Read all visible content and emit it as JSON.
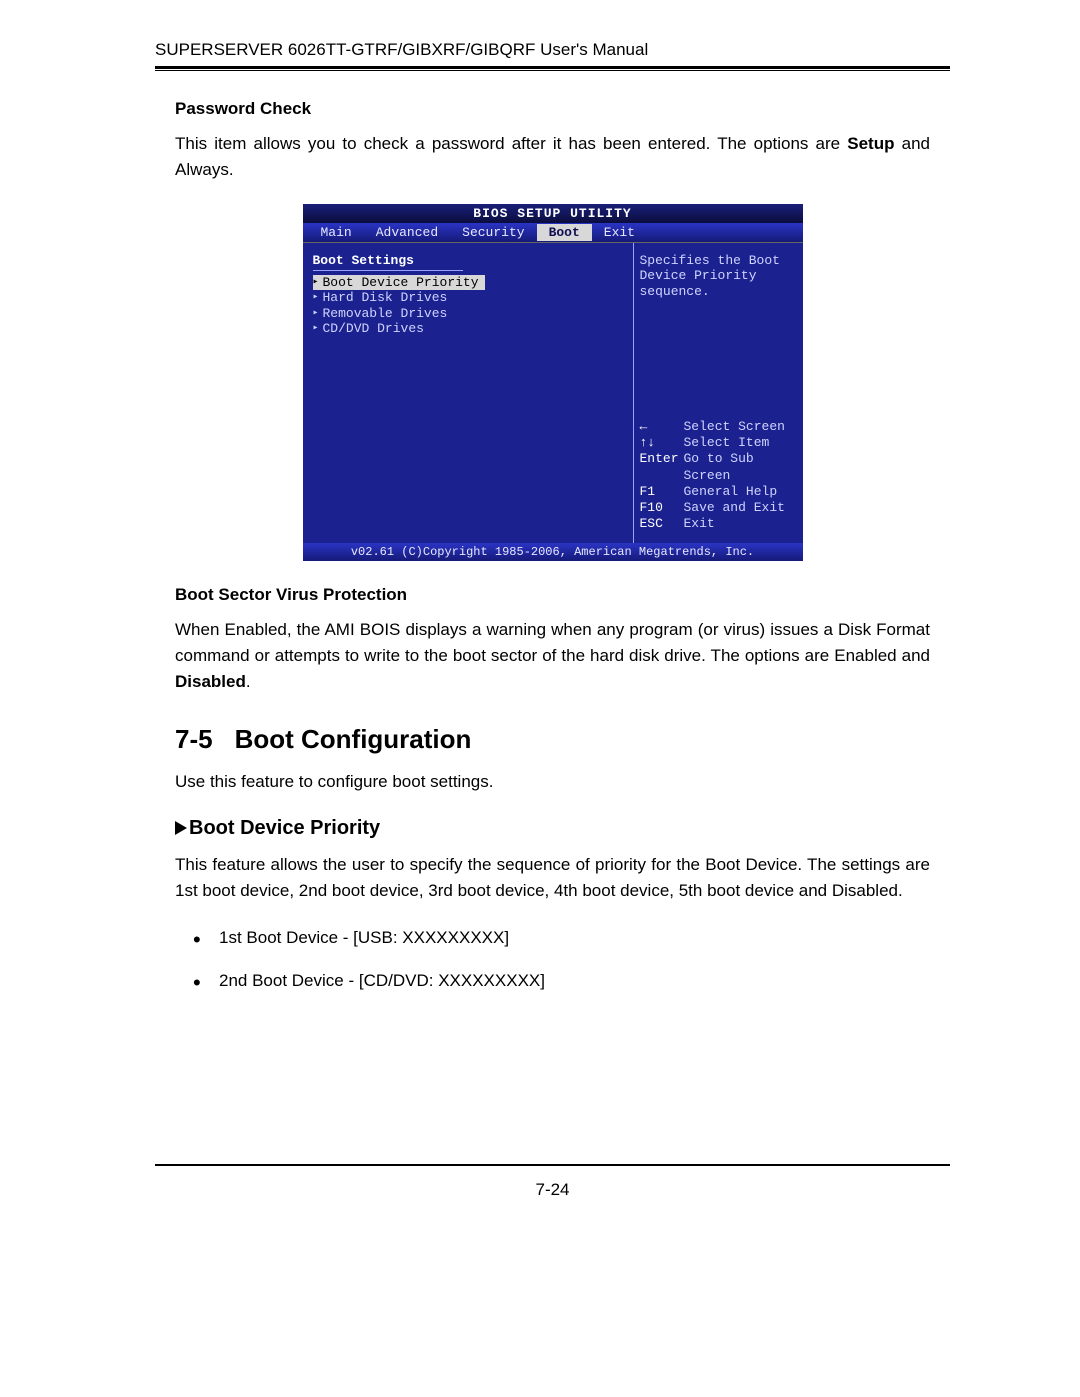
{
  "header": "SUPERSERVER 6026TT-GTRF/GIBXRF/GIBQRF User's Manual",
  "password_check": {
    "title": "Password Check",
    "text_a": "This item allows you to check a password after it has been entered. The options are ",
    "strong": "Setup",
    "text_b": " and Always."
  },
  "bios": {
    "title": "BIOS SETUP UTILITY",
    "tabs": [
      "Main",
      "Advanced",
      "Security",
      "Boot",
      "Exit"
    ],
    "active_tab_index": 3,
    "heading": "Boot Settings",
    "items": [
      "Boot Device Priority",
      "Hard Disk Drives",
      "Removable Drives",
      "CD/DVD Drives"
    ],
    "selected_item_index": 0,
    "help_top": "Specifies the Boot Device Priority sequence.",
    "keys": [
      {
        "k": "←",
        "d": "Select Screen"
      },
      {
        "k": "↑↓",
        "d": "Select Item"
      },
      {
        "k": "Enter",
        "d": "Go to Sub Screen"
      },
      {
        "k": "F1",
        "d": "General Help"
      },
      {
        "k": "F10",
        "d": "Save and Exit"
      },
      {
        "k": "ESC",
        "d": "Exit"
      }
    ],
    "footer": "v02.61 (C)Copyright 1985-2006, American Megatrends, Inc."
  },
  "boot_sector": {
    "title": "Boot Sector Virus Protection",
    "text_a": "When Enabled, the AMI BOIS displays a warning when any program (or virus) issues a Disk Format command or attempts to write to the boot sector of the hard disk drive. The options are Enabled and ",
    "strong": "Disabled",
    "text_b": "."
  },
  "section": {
    "num": "7-5",
    "title": "Boot Configuration",
    "intro": "Use this feature to configure boot settings."
  },
  "priority": {
    "title": "Boot Device Priority",
    "text": "This feature allows the user to specify the sequence of priority for the Boot Device. The settings are 1st boot device, 2nd boot device, 3rd boot device, 4th boot device, 5th boot device and Disabled.",
    "bullets": [
      "1st Boot Device - [USB: XXXXXXXXX]",
      "2nd Boot Device - [CD/DVD: XXXXXXXXX]"
    ]
  },
  "page_number": "7-24"
}
